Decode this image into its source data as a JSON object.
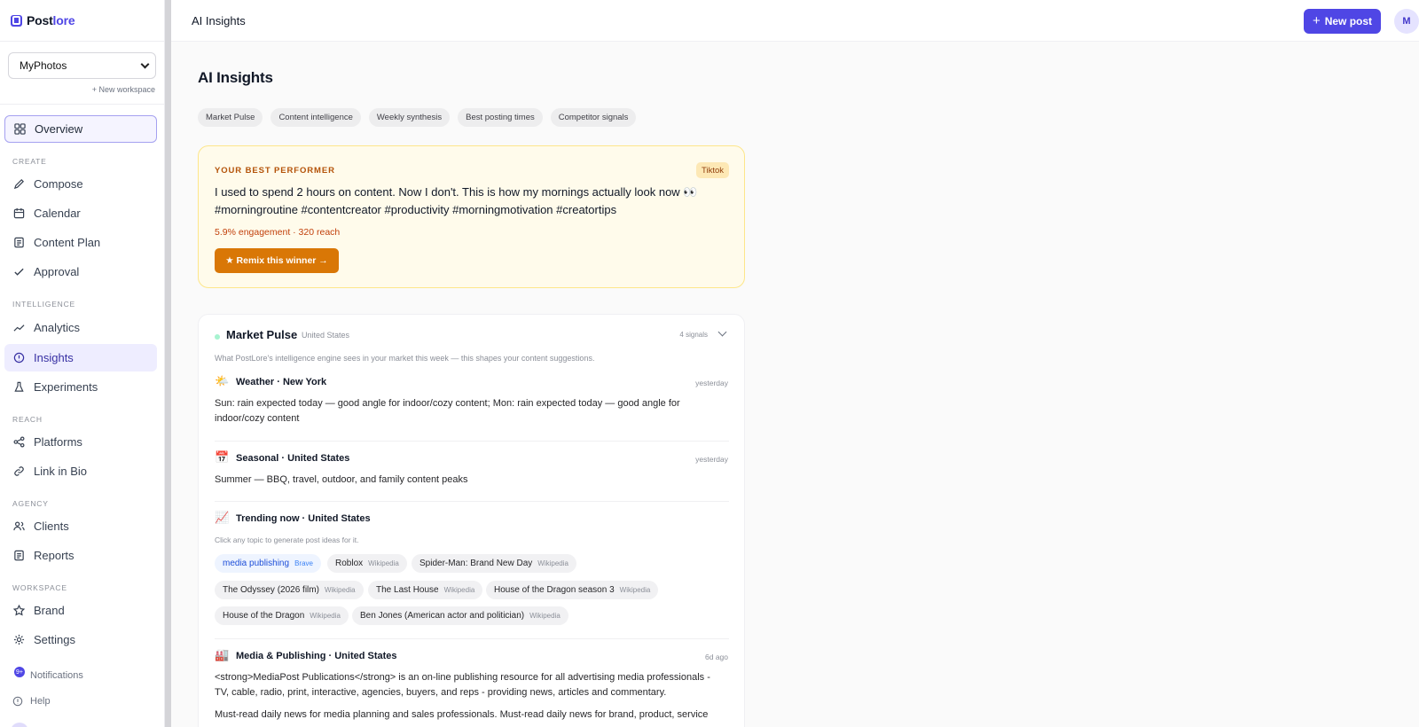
{
  "app": {
    "brand_prefix": "Post",
    "brand_suffix": "lore"
  },
  "sidebar": {
    "workspace": "MyPhotos",
    "new_workspace": "+ New workspace",
    "overview": "Overview",
    "sections": {
      "create": "CREATE",
      "intelligence": "INTELLIGENCE",
      "reach": "REACH",
      "agency": "AGENCY",
      "workspace": "WORKSPACE"
    },
    "items": {
      "compose": "Compose",
      "calendar": "Calendar",
      "content_plan": "Content Plan",
      "approval": "Approval",
      "analytics": "Analytics",
      "insights": "Insights",
      "experiments": "Experiments",
      "platforms": "Platforms",
      "link_in_bio": "Link in Bio",
      "clients": "Clients",
      "reports": "Reports",
      "brand": "Brand",
      "settings": "Settings"
    },
    "footer": {
      "notifications": "Notifications",
      "notifications_count": "9+",
      "help": "Help"
    }
  },
  "header": {
    "title": "AI Insights",
    "new_post": "New post",
    "avatar_initial": "M"
  },
  "main": {
    "title": "AI Insights",
    "chips": [
      "Market Pulse",
      "Content intelligence",
      "Weekly synthesis",
      "Best posting times",
      "Competitor signals"
    ],
    "best": {
      "label": "YOUR BEST PERFORMER",
      "platform": "Tiktok",
      "text": "I used to spend 2 hours on content. Now I don't. This is how my mornings actually look now 👀 #morningroutine #contentcreator #productivity #morningmotivation #creatortips",
      "stats": "5.9% engagement · 320 reach",
      "cta": "★ Remix this winner →"
    },
    "pulse": {
      "title": "Market Pulse",
      "region": "United States",
      "signals": "4 signals",
      "description": "What PostLore's intelligence engine sees in your market this week — this shapes your content suggestions.",
      "weather": {
        "emoji": "🌤️",
        "title": "Weather · New York",
        "time": "yesterday",
        "body": "Sun: rain expected today — good angle for indoor/cozy content; Mon: rain expected today — good angle for indoor/cozy content"
      },
      "seasonal": {
        "emoji": "📅",
        "title": "Seasonal · United States",
        "time": "yesterday",
        "body": "Summer — BBQ, travel, outdoor, and family content peaks"
      },
      "trending": {
        "emoji": "📈",
        "title": "Trending now · United States",
        "hint": "Click any topic to generate post ideas for it.",
        "topics": [
          {
            "label": "media publishing",
            "source": "Brave"
          },
          {
            "label": "Roblox",
            "source": "Wikipedia"
          },
          {
            "label": "Spider-Man: Brand New Day",
            "source": "Wikipedia"
          },
          {
            "label": "The Odyssey (2026 film)",
            "source": "Wikipedia"
          },
          {
            "label": "The Last House",
            "source": "Wikipedia"
          },
          {
            "label": "House of the Dragon season 3",
            "source": "Wikipedia"
          },
          {
            "label": "House of the Dragon",
            "source": "Wikipedia"
          },
          {
            "label": "Ben Jones (American actor and politician)",
            "source": "Wikipedia"
          }
        ]
      },
      "media": {
        "emoji": "🏭",
        "title": "Media & Publishing · United States",
        "time": "6d ago",
        "body1": "<strong>MediaPost Publications</strong> is an on-line publishing resource for all advertising media professionals - TV, cable, radio, print, interactive, agencies, buyers, and reps - providing news, articles and commentary.",
        "body2": "Must-read daily news for media planning and sales professionals. Must-read daily news for brand, product, service"
      }
    }
  }
}
